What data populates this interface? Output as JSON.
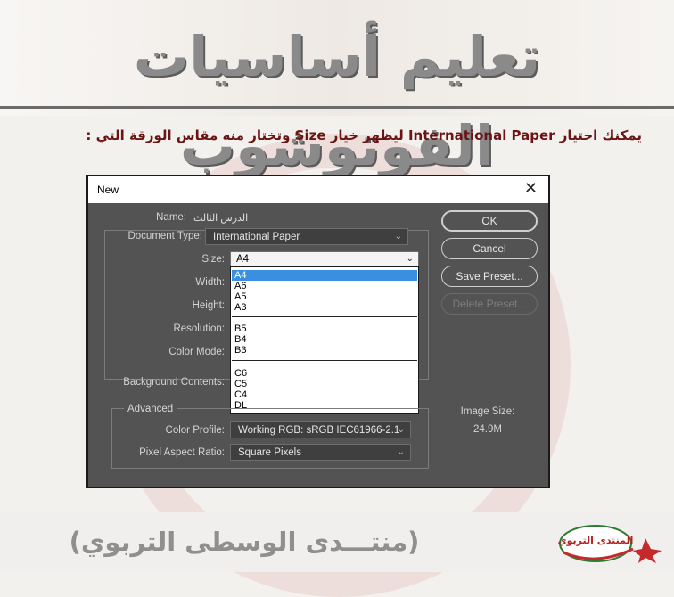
{
  "page": {
    "header_title": "تعليم أساسيات الفوتوشوب",
    "instruction": "يمكنك اختيار International Paper ليظهر خيار Size وتختار منه مقاس الورقة التي :",
    "footer_text": "(منتـــدى الوسطى التربوي)",
    "logo_text": "المنتدى التربوي"
  },
  "dialog": {
    "title": "New",
    "close_glyph": "✕",
    "labels": {
      "name": "Name:",
      "document_type": "Document Type:",
      "size": "Size:",
      "width": "Width:",
      "height": "Height:",
      "resolution": "Resolution:",
      "color_mode": "Color Mode:",
      "background_contents": "Background Contents:",
      "advanced": "Advanced",
      "color_profile": "Color Profile:",
      "pixel_aspect_ratio": "Pixel Aspect Ratio:",
      "image_size": "Image Size:"
    },
    "values": {
      "name": "الدرس الثالث",
      "document_type": "International Paper",
      "size": "A4",
      "color_profile": "Working RGB:  sRGB IEC61966-2.1",
      "pixel_aspect_ratio": "Square Pixels",
      "image_size": "24.9M"
    },
    "buttons": {
      "ok": "OK",
      "cancel": "Cancel",
      "save_preset": "Save Preset...",
      "delete_preset": "Delete Preset..."
    },
    "size_options": {
      "group_a": [
        "A4",
        "A6",
        "A5",
        "A3"
      ],
      "group_b": [
        "B5",
        "B4",
        "B3"
      ],
      "group_c": [
        "C6",
        "C5",
        "C4",
        "DL"
      ]
    }
  },
  "colors": {
    "dialog_bg": "#535353",
    "selected_option": "#3a8fe0",
    "instruction_text": "#6a1414"
  }
}
